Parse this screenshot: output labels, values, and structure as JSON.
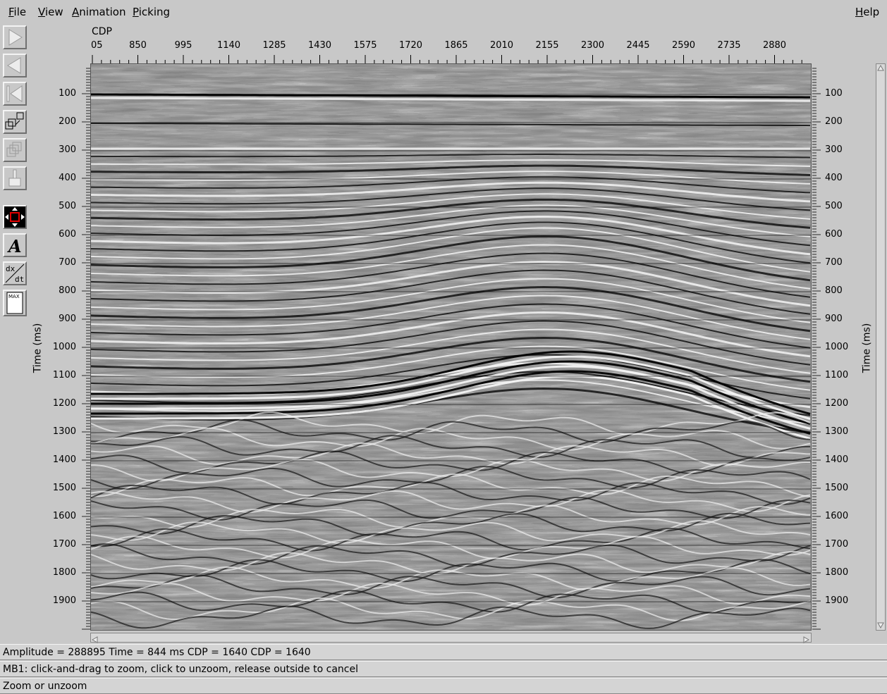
{
  "menubar": {
    "file": "File",
    "view": "View",
    "animation": "Animation",
    "picking": "Picking",
    "help": "Help"
  },
  "toolbar": {
    "icons": [
      "play-forward-icon",
      "play-backward-icon",
      "step-back-icon",
      "zoom-windows-icon",
      "overlay-windows-icon",
      "paint-brush-icon",
      "zoom-drag-icon",
      "annotate-text-icon",
      "dx-dt-icon",
      "max-clip-icon"
    ]
  },
  "x_axis": {
    "title": "CDP",
    "ticks": [
      "05",
      "850",
      "995",
      "1140",
      "1285",
      "1430",
      "1575",
      "1720",
      "1865",
      "2010",
      "2155",
      "2300",
      "2445",
      "2590",
      "2735",
      "2880"
    ]
  },
  "y_axis": {
    "title": "Time (ms)",
    "ticks": [
      "100",
      "200",
      "300",
      "400",
      "500",
      "600",
      "700",
      "800",
      "900",
      "1000",
      "1100",
      "1200",
      "1300",
      "1400",
      "1500",
      "1600",
      "1700",
      "1800",
      "1900"
    ]
  },
  "status": {
    "readout": "Amplitude = 288895  Time = 844 ms  CDP = 1640  CDP = 1640",
    "mouse_help": "MB1: click-and-drag to zoom, click to unzoom, release outside to cancel",
    "mode": "Zoom or unzoom"
  },
  "colors": {
    "background": "#c8c8c8",
    "seismic_mid": "#808080"
  }
}
